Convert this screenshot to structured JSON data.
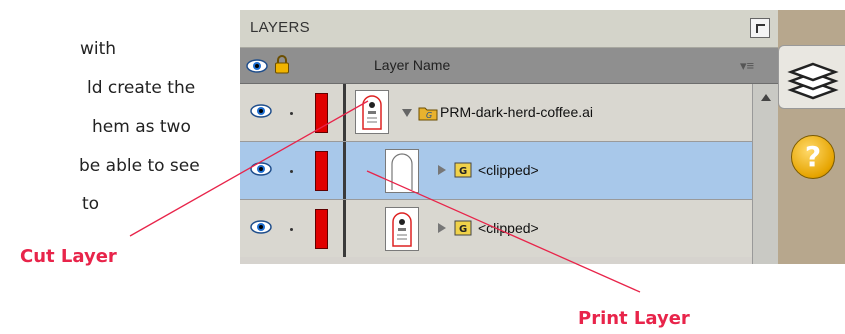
{
  "background_text": {
    "lines": [
      "with",
      "ld create the",
      "hem as two",
      "be able to see",
      "to"
    ]
  },
  "panel": {
    "title": "LAYERS",
    "column_header": "Layer Name",
    "rows": [
      {
        "name": "PRM-dark-herd-coffee.ai",
        "expanded": true,
        "selected": false,
        "color": "#e00000"
      },
      {
        "name": "<clipped>",
        "expanded": false,
        "selected": true,
        "badge": "G",
        "color": "#e00000"
      },
      {
        "name": "<clipped>",
        "expanded": false,
        "selected": false,
        "badge": "G",
        "color": "#e00000"
      }
    ]
  },
  "side": {
    "help_label": "?"
  },
  "callouts": {
    "cut_layer": "Cut Layer",
    "print_layer": "Print Layer"
  },
  "colors": {
    "callout": "#e8244a",
    "selection": "#a8c8ea",
    "layer_color": "#e00000"
  }
}
